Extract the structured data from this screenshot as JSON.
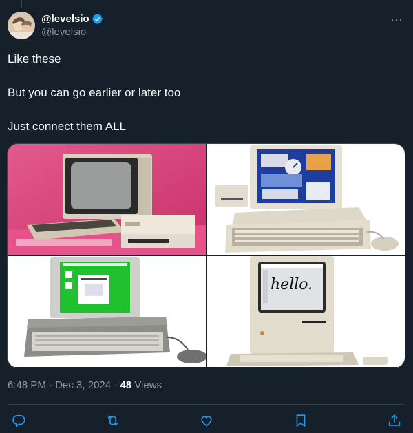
{
  "author": {
    "display_name": "@levelsio",
    "handle": "@levelsio",
    "verified": true,
    "avatar_icon": "avatar-photo"
  },
  "more_icon": "⋯",
  "tweet": {
    "lines": [
      "Like these",
      "But you can go earlier or later too",
      "Just connect them ALL"
    ]
  },
  "media": {
    "images": [
      {
        "name": "commodore-computer-image",
        "bg": "#d8437a"
      },
      {
        "name": "amiga-computer-image",
        "bg": "#ffffff"
      },
      {
        "name": "atari-st-computer-image",
        "bg": "#ffffff"
      },
      {
        "name": "macintosh-computer-image",
        "bg": "#ffffff"
      }
    ],
    "mac_screen_text": "hello."
  },
  "meta": {
    "time": "6:48 PM",
    "separator": "·",
    "date": "Dec 3, 2024",
    "views_count": "48",
    "views_label": "Views"
  },
  "actions": [
    "reply-icon",
    "retweet-icon",
    "like-icon",
    "bookmark-icon",
    "share-icon"
  ],
  "colors": {
    "background": "#15202b",
    "text": "#f7f9f9",
    "secondary": "#8b98a5",
    "verified": "#1d9bf0",
    "border": "#38444d"
  }
}
